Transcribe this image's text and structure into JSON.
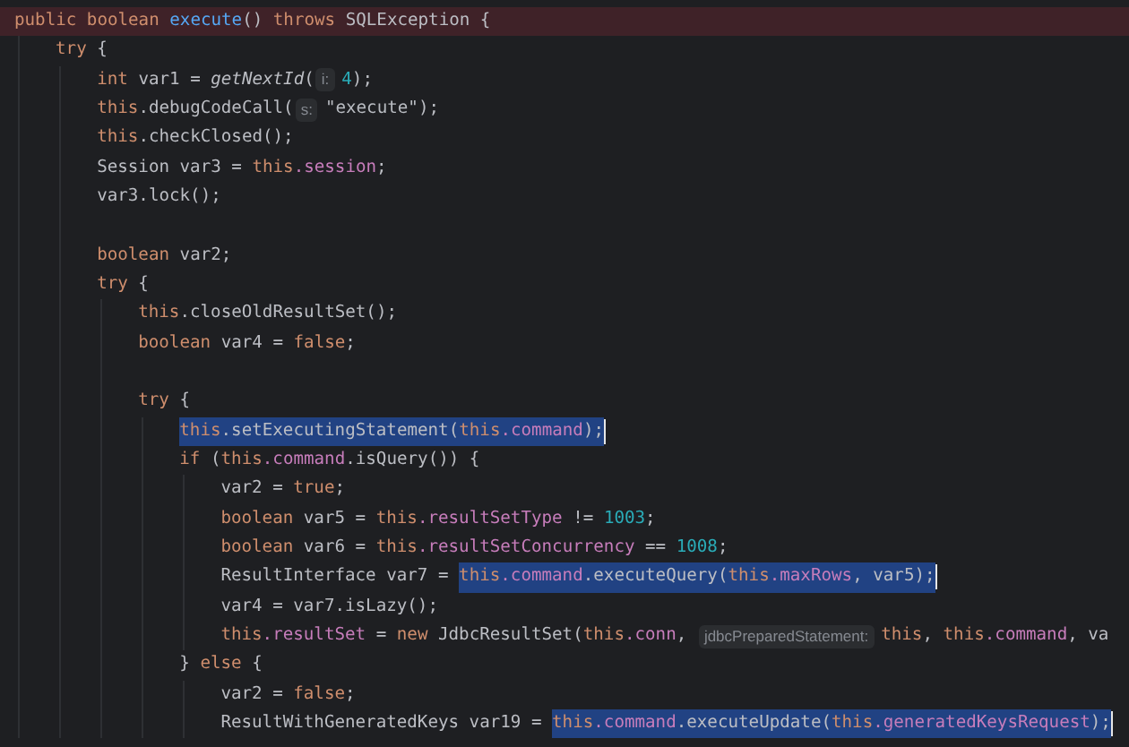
{
  "editor": {
    "lines": [
      {
        "kind": "code",
        "current": true,
        "caret": false,
        "segments": [
          {
            "kind": "code",
            "selected": false,
            "tokens": [
              {
                "text": "public boolean ",
                "kind": "keyword"
              },
              {
                "text": "execute",
                "kind": "declaration"
              },
              {
                "text": "() ",
                "kind": "plain"
              },
              {
                "text": "throws ",
                "kind": "keyword"
              },
              {
                "text": "SQLException {",
                "kind": "plain"
              }
            ]
          }
        ],
        "children": [
          {
            "kind": "code",
            "current": false,
            "caret": false,
            "segments": [
              {
                "kind": "code",
                "selected": false,
                "tokens": [
                  {
                    "text": "try",
                    "kind": "keyword"
                  },
                  {
                    "text": " {",
                    "kind": "plain"
                  }
                ]
              }
            ],
            "children": [
              {
                "kind": "code",
                "current": false,
                "caret": false,
                "segments": [
                  {
                    "kind": "code",
                    "selected": false,
                    "tokens": [
                      {
                        "text": "int ",
                        "kind": "keyword"
                      },
                      {
                        "text": "var1 = ",
                        "kind": "plain"
                      },
                      {
                        "text": "getNextId",
                        "kind": "static"
                      },
                      {
                        "text": "(",
                        "kind": "plain"
                      }
                    ]
                  },
                  {
                    "kind": "hint",
                    "text": "i:"
                  },
                  {
                    "kind": "code",
                    "selected": false,
                    "tokens": [
                      {
                        "text": "4",
                        "kind": "number"
                      },
                      {
                        "text": ");",
                        "kind": "plain"
                      }
                    ]
                  }
                ]
              },
              {
                "kind": "code",
                "current": false,
                "caret": false,
                "segments": [
                  {
                    "kind": "code",
                    "selected": false,
                    "tokens": [
                      {
                        "text": "this",
                        "kind": "keyword"
                      },
                      {
                        "text": ".debugCodeCall(",
                        "kind": "plain"
                      }
                    ]
                  },
                  {
                    "kind": "hint",
                    "text": "s:"
                  },
                  {
                    "kind": "code",
                    "selected": false,
                    "tokens": [
                      {
                        "text": "\"execute\"",
                        "kind": "string"
                      },
                      {
                        "text": ");",
                        "kind": "plain"
                      }
                    ]
                  }
                ]
              },
              {
                "kind": "code",
                "current": false,
                "caret": false,
                "segments": [
                  {
                    "kind": "code",
                    "selected": false,
                    "tokens": [
                      {
                        "text": "this",
                        "kind": "keyword"
                      },
                      {
                        "text": ".checkClosed();",
                        "kind": "plain"
                      }
                    ]
                  }
                ]
              },
              {
                "kind": "code",
                "current": false,
                "caret": false,
                "segments": [
                  {
                    "kind": "code",
                    "selected": false,
                    "tokens": [
                      {
                        "text": "Session var3 = ",
                        "kind": "plain"
                      },
                      {
                        "text": "this",
                        "kind": "keyword"
                      },
                      {
                        "text": ".session",
                        "kind": "field"
                      },
                      {
                        "text": ";",
                        "kind": "plain"
                      }
                    ]
                  }
                ]
              },
              {
                "kind": "code",
                "current": false,
                "caret": false,
                "segments": [
                  {
                    "kind": "code",
                    "selected": false,
                    "tokens": [
                      {
                        "text": "var3.lock();",
                        "kind": "plain"
                      }
                    ]
                  }
                ]
              },
              {
                "kind": "blank"
              },
              {
                "kind": "code",
                "current": false,
                "caret": false,
                "segments": [
                  {
                    "kind": "code",
                    "selected": false,
                    "tokens": [
                      {
                        "text": "boolean ",
                        "kind": "keyword"
                      },
                      {
                        "text": "var2;",
                        "kind": "plain"
                      }
                    ]
                  }
                ]
              },
              {
                "kind": "code",
                "current": false,
                "caret": false,
                "segments": [
                  {
                    "kind": "code",
                    "selected": false,
                    "tokens": [
                      {
                        "text": "try",
                        "kind": "keyword"
                      },
                      {
                        "text": " {",
                        "kind": "plain"
                      }
                    ]
                  }
                ],
                "children": [
                  {
                    "kind": "code",
                    "current": false,
                    "caret": false,
                    "segments": [
                      {
                        "kind": "code",
                        "selected": false,
                        "tokens": [
                          {
                            "text": "this",
                            "kind": "keyword"
                          },
                          {
                            "text": ".closeOldResultSet();",
                            "kind": "plain"
                          }
                        ]
                      }
                    ]
                  },
                  {
                    "kind": "code",
                    "current": false,
                    "caret": false,
                    "segments": [
                      {
                        "kind": "code",
                        "selected": false,
                        "tokens": [
                          {
                            "text": "boolean ",
                            "kind": "keyword"
                          },
                          {
                            "text": "var4 = ",
                            "kind": "plain"
                          },
                          {
                            "text": "false",
                            "kind": "keyword"
                          },
                          {
                            "text": ";",
                            "kind": "plain"
                          }
                        ]
                      }
                    ]
                  },
                  {
                    "kind": "blank"
                  },
                  {
                    "kind": "code",
                    "current": false,
                    "caret": false,
                    "segments": [
                      {
                        "kind": "code",
                        "selected": false,
                        "tokens": [
                          {
                            "text": "try",
                            "kind": "keyword"
                          },
                          {
                            "text": " {",
                            "kind": "plain"
                          }
                        ]
                      }
                    ],
                    "children": [
                      {
                        "kind": "code",
                        "current": false,
                        "caret": true,
                        "segments": [
                          {
                            "kind": "code",
                            "selected": true,
                            "tokens": [
                              {
                                "text": "this",
                                "kind": "keyword"
                              },
                              {
                                "text": ".setExecutingStatement(",
                                "kind": "plain"
                              },
                              {
                                "text": "this",
                                "kind": "keyword"
                              },
                              {
                                "text": ".command",
                                "kind": "field"
                              },
                              {
                                "text": ");",
                                "kind": "plain"
                              }
                            ]
                          }
                        ]
                      },
                      {
                        "kind": "code",
                        "current": false,
                        "caret": false,
                        "segments": [
                          {
                            "kind": "code",
                            "selected": false,
                            "tokens": [
                              {
                                "text": "if",
                                "kind": "keyword"
                              },
                              {
                                "text": " (",
                                "kind": "plain"
                              },
                              {
                                "text": "this",
                                "kind": "keyword"
                              },
                              {
                                "text": ".command",
                                "kind": "field"
                              },
                              {
                                "text": ".isQuery()) {",
                                "kind": "plain"
                              }
                            ]
                          }
                        ],
                        "children": [
                          {
                            "kind": "code",
                            "current": false,
                            "caret": false,
                            "segments": [
                              {
                                "kind": "code",
                                "selected": false,
                                "tokens": [
                                  {
                                    "text": "var2 = ",
                                    "kind": "plain"
                                  },
                                  {
                                    "text": "true",
                                    "kind": "keyword"
                                  },
                                  {
                                    "text": ";",
                                    "kind": "plain"
                                  }
                                ]
                              }
                            ]
                          },
                          {
                            "kind": "code",
                            "current": false,
                            "caret": false,
                            "segments": [
                              {
                                "kind": "code",
                                "selected": false,
                                "tokens": [
                                  {
                                    "text": "boolean ",
                                    "kind": "keyword"
                                  },
                                  {
                                    "text": "var5 = ",
                                    "kind": "plain"
                                  },
                                  {
                                    "text": "this",
                                    "kind": "keyword"
                                  },
                                  {
                                    "text": ".resultSetType",
                                    "kind": "field"
                                  },
                                  {
                                    "text": " != ",
                                    "kind": "plain"
                                  },
                                  {
                                    "text": "1003",
                                    "kind": "number"
                                  },
                                  {
                                    "text": ";",
                                    "kind": "plain"
                                  }
                                ]
                              }
                            ]
                          },
                          {
                            "kind": "code",
                            "current": false,
                            "caret": false,
                            "segments": [
                              {
                                "kind": "code",
                                "selected": false,
                                "tokens": [
                                  {
                                    "text": "boolean ",
                                    "kind": "keyword"
                                  },
                                  {
                                    "text": "var6 = ",
                                    "kind": "plain"
                                  },
                                  {
                                    "text": "this",
                                    "kind": "keyword"
                                  },
                                  {
                                    "text": ".resultSetConcurrency",
                                    "kind": "field"
                                  },
                                  {
                                    "text": " == ",
                                    "kind": "plain"
                                  },
                                  {
                                    "text": "1008",
                                    "kind": "number"
                                  },
                                  {
                                    "text": ";",
                                    "kind": "plain"
                                  }
                                ]
                              }
                            ]
                          },
                          {
                            "kind": "code",
                            "current": false,
                            "caret": true,
                            "segments": [
                              {
                                "kind": "code",
                                "selected": false,
                                "tokens": [
                                  {
                                    "text": "ResultInterface var7 = ",
                                    "kind": "plain"
                                  }
                                ]
                              },
                              {
                                "kind": "code",
                                "selected": true,
                                "tokens": [
                                  {
                                    "text": "this",
                                    "kind": "keyword"
                                  },
                                  {
                                    "text": ".command",
                                    "kind": "field"
                                  },
                                  {
                                    "text": ".executeQuery(",
                                    "kind": "plain"
                                  },
                                  {
                                    "text": "this",
                                    "kind": "keyword"
                                  },
                                  {
                                    "text": ".maxRows",
                                    "kind": "field"
                                  },
                                  {
                                    "text": ", var5);",
                                    "kind": "plain"
                                  }
                                ]
                              }
                            ]
                          },
                          {
                            "kind": "code",
                            "current": false,
                            "caret": false,
                            "segments": [
                              {
                                "kind": "code",
                                "selected": false,
                                "tokens": [
                                  {
                                    "text": "var4 = var7.isLazy();",
                                    "kind": "plain"
                                  }
                                ]
                              }
                            ]
                          },
                          {
                            "kind": "code",
                            "current": false,
                            "caret": false,
                            "segments": [
                              {
                                "kind": "code",
                                "selected": false,
                                "tokens": [
                                  {
                                    "text": "this",
                                    "kind": "keyword"
                                  },
                                  {
                                    "text": ".resultSet",
                                    "kind": "field"
                                  },
                                  {
                                    "text": " = ",
                                    "kind": "plain"
                                  },
                                  {
                                    "text": "new ",
                                    "kind": "keyword"
                                  },
                                  {
                                    "text": "JdbcResultSet(",
                                    "kind": "plain"
                                  },
                                  {
                                    "text": "this",
                                    "kind": "keyword"
                                  },
                                  {
                                    "text": ".conn",
                                    "kind": "field"
                                  },
                                  {
                                    "text": ", ",
                                    "kind": "plain"
                                  }
                                ]
                              },
                              {
                                "kind": "hint",
                                "text": "jdbcPreparedStatement:"
                              },
                              {
                                "kind": "code",
                                "selected": false,
                                "tokens": [
                                  {
                                    "text": "this",
                                    "kind": "keyword"
                                  },
                                  {
                                    "text": ", ",
                                    "kind": "plain"
                                  },
                                  {
                                    "text": "this",
                                    "kind": "keyword"
                                  },
                                  {
                                    "text": ".command",
                                    "kind": "field"
                                  },
                                  {
                                    "text": ", va",
                                    "kind": "plain"
                                  }
                                ]
                              }
                            ]
                          }
                        ]
                      },
                      {
                        "kind": "code",
                        "current": false,
                        "caret": false,
                        "segments": [
                          {
                            "kind": "code",
                            "selected": false,
                            "tokens": [
                              {
                                "text": "} ",
                                "kind": "plain"
                              },
                              {
                                "text": "else",
                                "kind": "keyword"
                              },
                              {
                                "text": " {",
                                "kind": "plain"
                              }
                            ]
                          }
                        ],
                        "children": [
                          {
                            "kind": "code",
                            "current": false,
                            "caret": false,
                            "segments": [
                              {
                                "kind": "code",
                                "selected": false,
                                "tokens": [
                                  {
                                    "text": "var2 = ",
                                    "kind": "plain"
                                  },
                                  {
                                    "text": "false",
                                    "kind": "keyword"
                                  },
                                  {
                                    "text": ";",
                                    "kind": "plain"
                                  }
                                ]
                              }
                            ]
                          },
                          {
                            "kind": "code",
                            "current": false,
                            "caret": true,
                            "segments": [
                              {
                                "kind": "code",
                                "selected": false,
                                "tokens": [
                                  {
                                    "text": "ResultWithGeneratedKeys var19 = ",
                                    "kind": "plain"
                                  }
                                ]
                              },
                              {
                                "kind": "code",
                                "selected": true,
                                "tokens": [
                                  {
                                    "text": "this",
                                    "kind": "keyword"
                                  },
                                  {
                                    "text": ".command",
                                    "kind": "field"
                                  },
                                  {
                                    "text": ".executeUpdate(",
                                    "kind": "plain"
                                  },
                                  {
                                    "text": "this",
                                    "kind": "keyword"
                                  },
                                  {
                                    "text": ".generatedKeysRequest",
                                    "kind": "field"
                                  },
                                  {
                                    "text": ");",
                                    "kind": "plain"
                                  }
                                ]
                              }
                            ]
                          }
                        ]
                      }
                    ]
                  }
                ]
              }
            ]
          }
        ]
      }
    ]
  }
}
